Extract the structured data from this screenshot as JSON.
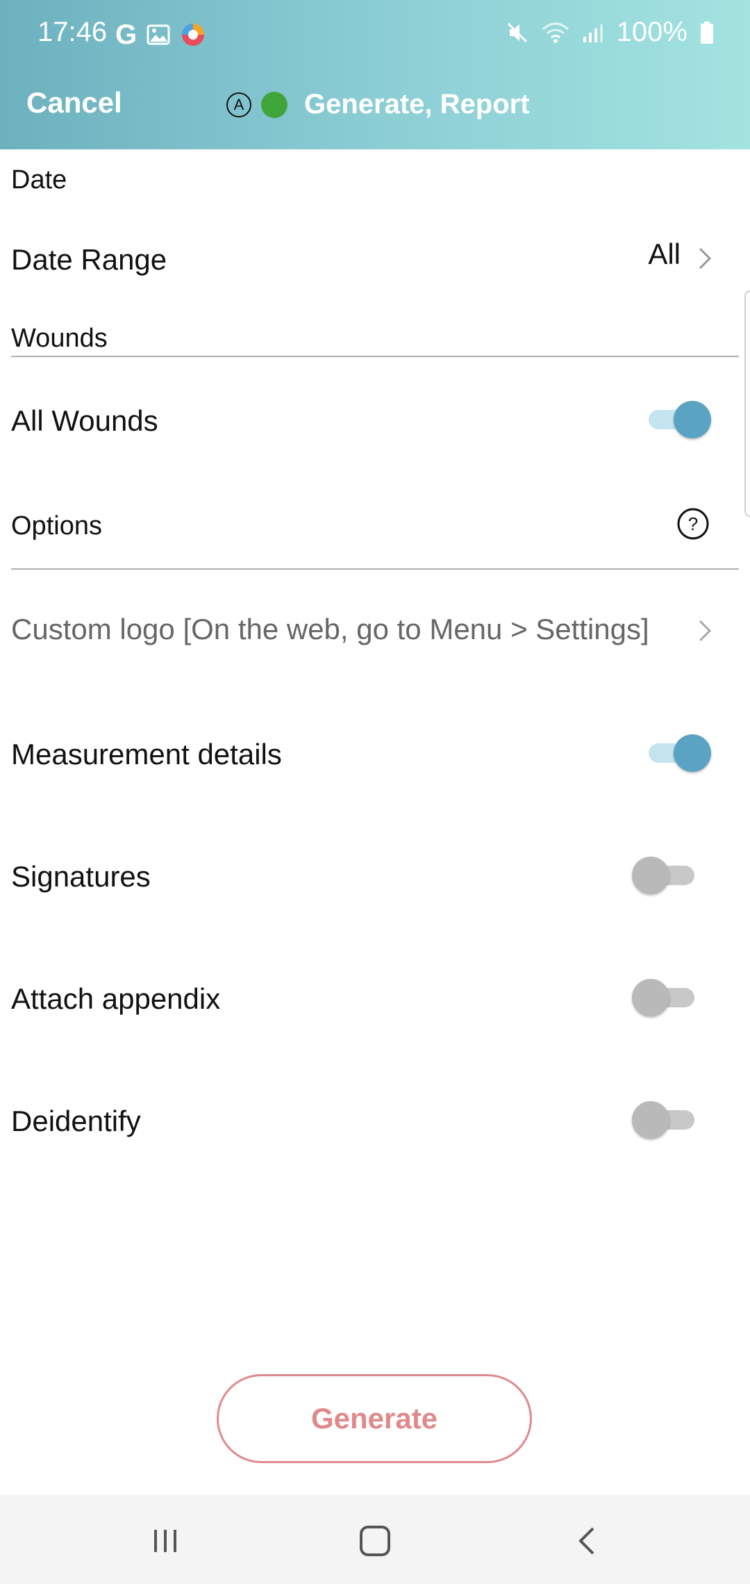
{
  "status_bar": {
    "time": "17:46",
    "battery": "100%",
    "left_icons": [
      "google-g-icon",
      "image-icon",
      "app-icon"
    ],
    "right_icons": [
      "mute-icon",
      "wifi-icon",
      "signal-icon",
      "battery-icon"
    ]
  },
  "toolbar": {
    "cancel_label": "Cancel",
    "badge_letter": "A",
    "title": "Generate, Report",
    "status_dot_color": "#3fa53b"
  },
  "date_section": {
    "header": "Date",
    "date_range_label": "Date Range",
    "date_range_value": "All"
  },
  "wounds_section": {
    "header": "Wounds",
    "all_wounds_label": "All Wounds",
    "all_wounds_on": true
  },
  "options_section": {
    "header": "Options",
    "custom_logo_label": "Custom logo [On the web, go to Menu > Settings]",
    "items": [
      {
        "label": "Measurement details",
        "on": true
      },
      {
        "label": "Signatures",
        "on": false
      },
      {
        "label": "Attach appendix",
        "on": false
      },
      {
        "label": "Deidentify",
        "on": false
      }
    ]
  },
  "generate_label": "Generate",
  "colors": {
    "accent": "#5aa3c2",
    "generate": "#e0898b",
    "header_gradient_start": "#6db1bf",
    "header_gradient_end": "#a3e3e0"
  }
}
